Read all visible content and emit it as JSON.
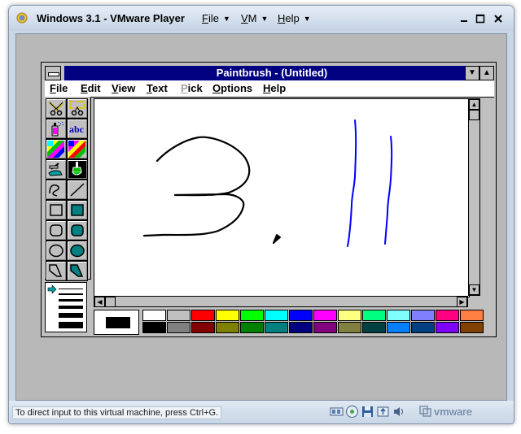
{
  "host": {
    "title": "Windows 3.1 - VMware Player",
    "menus": [
      {
        "label": "File",
        "hotkey": "F",
        "rest": "ile"
      },
      {
        "label": "VM",
        "hotkey": "V",
        "rest": "M"
      },
      {
        "label": "Help",
        "hotkey": "H",
        "rest": "elp"
      }
    ],
    "window_controls": [
      "minimize",
      "maximize",
      "close"
    ],
    "status_hint": "To direct input to this virtual machine, press Ctrl+G.",
    "tray_icons": [
      "network-adapter-icon",
      "cd-rom-icon",
      "floppy-icon",
      "usb-icon",
      "sound-icon"
    ],
    "brand": {
      "logo_prefix": "vm",
      "logo_suffix": "ware"
    }
  },
  "paintbrush": {
    "title": "Paintbrush - (Untitled)",
    "menus": [
      {
        "label": "File",
        "hotkey": "F",
        "rest": "ile",
        "enabled": true
      },
      {
        "label": "Edit",
        "hotkey": "E",
        "rest": "dit",
        "enabled": true
      },
      {
        "label": "View",
        "hotkey": "V",
        "rest": "iew",
        "enabled": true
      },
      {
        "label": "Text",
        "hotkey": "T",
        "rest": "ext",
        "enabled": true
      },
      {
        "label": "Pick",
        "hotkey": "P",
        "rest": "ick",
        "enabled": false
      },
      {
        "label": "Options",
        "hotkey": "O",
        "rest": "ptions",
        "enabled": true
      },
      {
        "label": "Help",
        "hotkey": "H",
        "rest": "elp",
        "enabled": true
      }
    ],
    "tools": [
      "scissors",
      "pick",
      "airbrush",
      "text",
      "color-eraser",
      "eraser",
      "paint-roller",
      "brush",
      "curve",
      "line",
      "box",
      "filled-box",
      "rounded-box",
      "filled-rounded-box",
      "circle",
      "filled-circle",
      "polygon",
      "filled-polygon"
    ],
    "text_tool_label": "abc",
    "selected_tool": "brush",
    "palette": {
      "foreground": "#000000",
      "background": "#ffffff",
      "top_row": [
        "#ffffff",
        "#c0c0c0",
        "#ff0000",
        "#ffff00",
        "#00ff00",
        "#00ffff",
        "#0000ff",
        "#ff00ff",
        "#ffff80",
        "#00ff80",
        "#80ffff",
        "#8080ff",
        "#ff0080",
        "#ff8040"
      ],
      "bottom_row": [
        "#000000",
        "#808080",
        "#800000",
        "#808000",
        "#008000",
        "#008080",
        "#000080",
        "#800080",
        "#808040",
        "#004040",
        "#0080ff",
        "#004080",
        "#8000ff",
        "#804000"
      ]
    },
    "drawing": {
      "stroke_colors": [
        "#000000",
        "#0000ff"
      ]
    }
  }
}
